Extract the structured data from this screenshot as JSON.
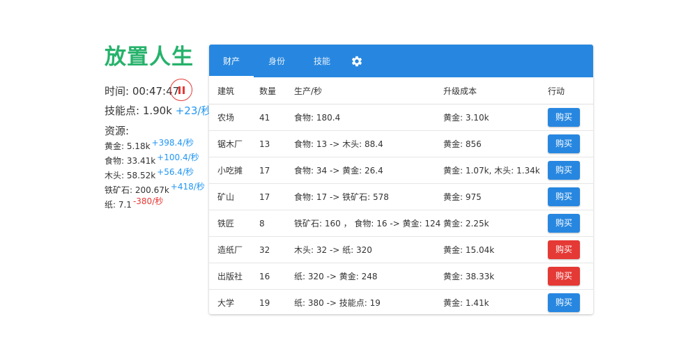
{
  "game": {
    "title": "放置人生",
    "time_label": "时间: 00:47:47",
    "skill_label": "技能点: 1.90k",
    "skill_rate": "+23/秒",
    "resources_title": "资源:",
    "resources": [
      {
        "label": "黄金: 5.18k",
        "rate": "+398.4/秒",
        "rate_color": "#2196f3"
      },
      {
        "label": "食物: 33.41k",
        "rate": "+100.4/秒",
        "rate_color": "#2196f3"
      },
      {
        "label": "木头: 58.52k",
        "rate": "+56.4/秒",
        "rate_color": "#2196f3"
      },
      {
        "label": "铁矿石: 200.67k",
        "rate": "+418/秒",
        "rate_color": "#2196f3"
      },
      {
        "label": "纸: 7.1",
        "rate": "-380/秒",
        "rate_color": "#e53935"
      }
    ]
  },
  "tabs": [
    {
      "label": "财产",
      "active": true
    },
    {
      "label": "身份",
      "active": false
    },
    {
      "label": "技能",
      "active": false
    }
  ],
  "settings_icon": "gear-icon",
  "table": {
    "headers": [
      "建筑",
      "数量",
      "生产/秒",
      "升级成本",
      "行动"
    ],
    "rows": [
      {
        "building": "农场",
        "count": "41",
        "production": "食物: 180.4",
        "cost": "黄金: 3.10k",
        "action": "购买",
        "affordable": true
      },
      {
        "building": "锯木厂",
        "count": "13",
        "production": "食物: 13 -> 木头: 88.4",
        "cost": "黄金: 856",
        "action": "购买",
        "affordable": true
      },
      {
        "building": "小吃摊",
        "count": "17",
        "production": "食物: 34 -> 黄金: 26.4",
        "cost": "黄金: 1.07k, 木头: 1.34k",
        "action": "购买",
        "affordable": true
      },
      {
        "building": "矿山",
        "count": "17",
        "production": "食物: 17 -> 铁矿石: 578",
        "cost": "黄金: 975",
        "action": "购买",
        "affordable": true
      },
      {
        "building": "铁匠",
        "count": "8",
        "production": "铁矿石: 160 ，  食物: 16 -> 黄金: 124",
        "cost": "黄金: 2.25k",
        "action": "购买",
        "affordable": true
      },
      {
        "building": "造纸厂",
        "count": "32",
        "production": "木头: 32 -> 纸: 320",
        "cost": "黄金: 15.04k",
        "action": "购买",
        "affordable": false
      },
      {
        "building": "出版社",
        "count": "16",
        "production": "纸: 320 -> 黄金: 248",
        "cost": "黄金: 38.33k",
        "action": "购买",
        "affordable": false
      },
      {
        "building": "大学",
        "count": "19",
        "production": "纸: 380 -> 技能点: 19",
        "cost": "黄金: 1.41k",
        "action": "购买",
        "affordable": true
      }
    ]
  },
  "colors": {
    "title_green": "#26b26b",
    "primary_blue": "#2787e0",
    "danger_red": "#e53935",
    "rate_blue": "#2196f3"
  }
}
